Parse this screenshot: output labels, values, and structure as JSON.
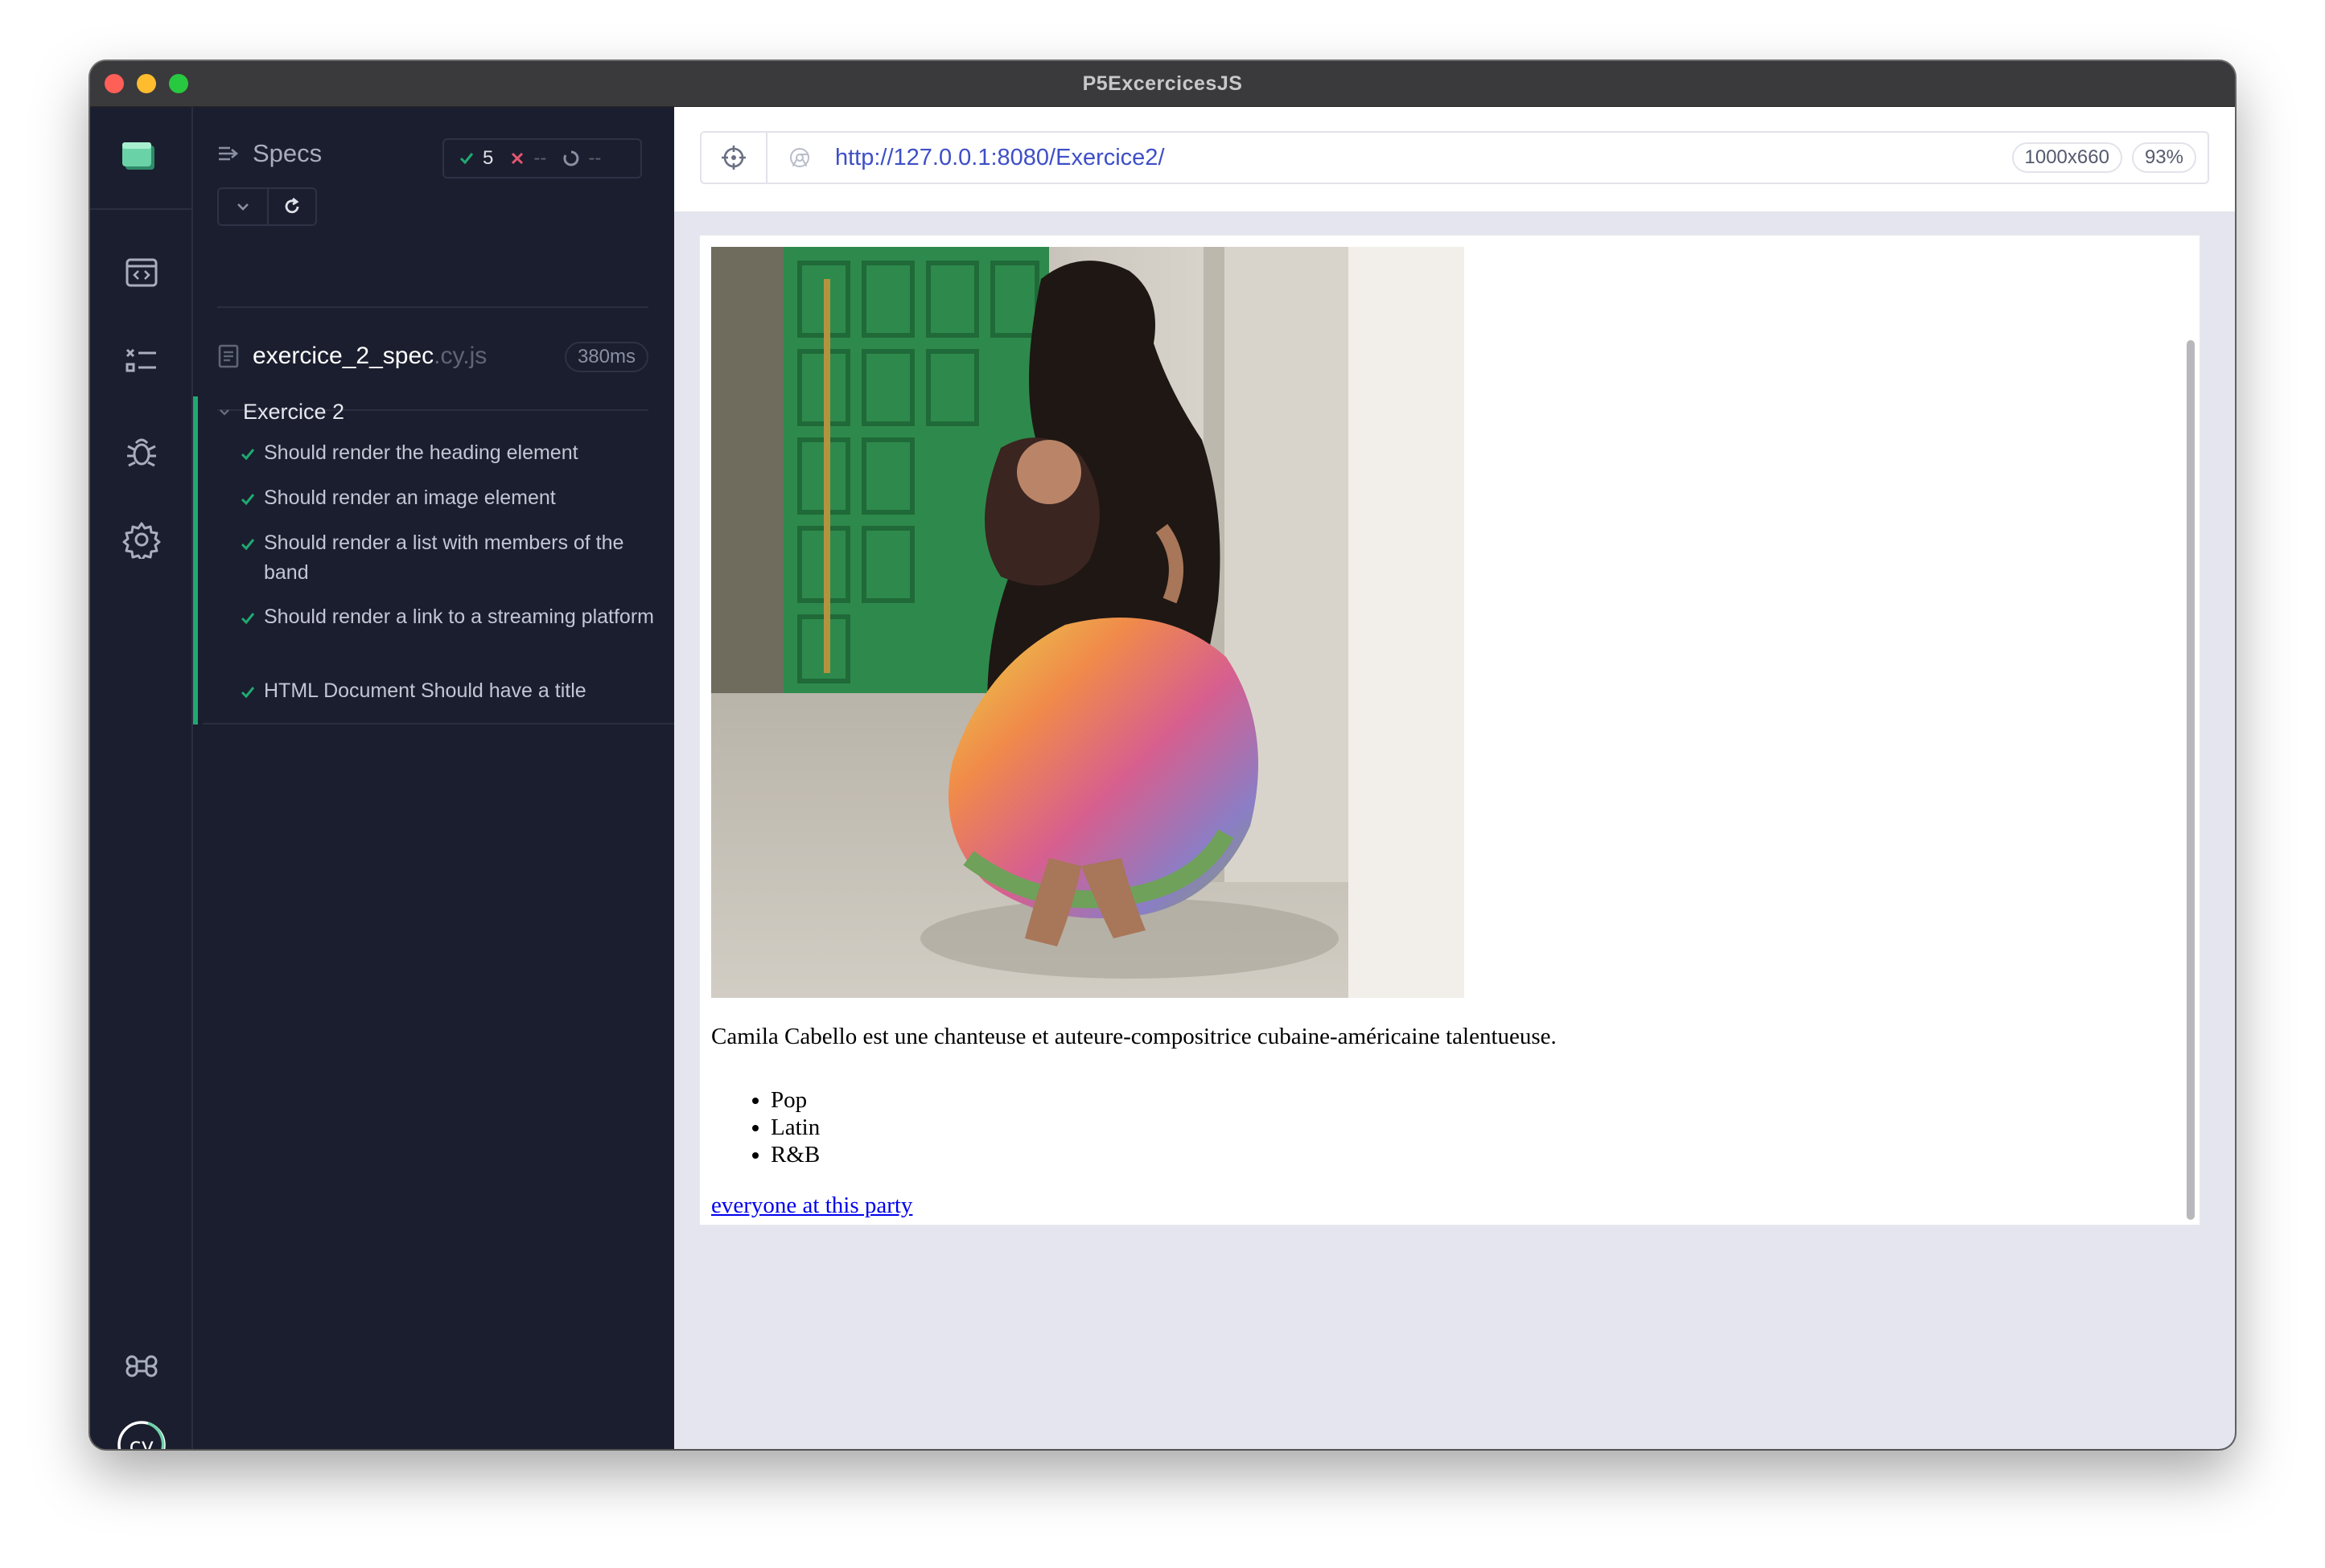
{
  "window": {
    "title": "P5ExcercicesJS"
  },
  "rail": {
    "icons": [
      "specs-list-icon",
      "runs-icon",
      "debug-icon",
      "settings-icon",
      "keyboard-shortcuts-icon",
      "cypress-logo"
    ]
  },
  "reporter": {
    "specs_label": "Specs",
    "stats": {
      "passed": "5",
      "failed": "--",
      "pending": "--"
    },
    "spec_file": {
      "name": "exercice_2_spec",
      "ext": ".cy.js",
      "duration": "380ms"
    },
    "suite": {
      "title": "Exercice 2",
      "tests": [
        {
          "label": "Should render the heading element",
          "status": "passed"
        },
        {
          "label": "Should render an image element",
          "status": "passed"
        },
        {
          "label": "Should render a list with members of the band",
          "status": "passed"
        },
        {
          "label": "Should render a link to a streaming platform",
          "status": "passed"
        },
        {
          "label": "HTML Document Should have a title",
          "status": "passed"
        }
      ]
    }
  },
  "browser": {
    "url": "http://127.0.0.1:8080/Exercice2/",
    "viewport": "1000x660",
    "zoom": "93%"
  },
  "page": {
    "paragraph": "Camila Cabello est une chanteuse et auteure-compositrice cubaine-américaine talentueuse.",
    "list": [
      "Pop",
      "Latin",
      "R&B"
    ],
    "link": "everyone at this party"
  },
  "colors": {
    "pass": "#1fa971",
    "fail": "#e45770",
    "link": "#0000ee",
    "url": "#3e4fc7"
  }
}
